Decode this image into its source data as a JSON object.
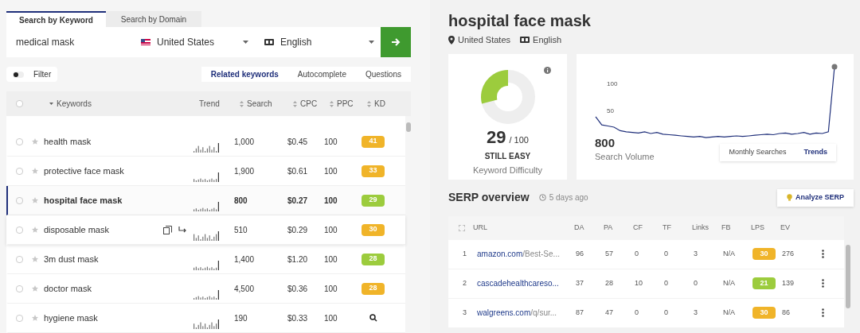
{
  "search_tabs": [
    {
      "label": "Search by Keyword",
      "selected": true
    },
    {
      "label": "Search by Domain",
      "selected": false
    }
  ],
  "search": {
    "value": "medical mask",
    "country": "United States",
    "language": "English"
  },
  "filter": {
    "label": "Filter",
    "on": false
  },
  "list_tabs": [
    {
      "label": "Related keywords",
      "selected": true
    },
    {
      "label": "Autocomplete",
      "selected": false
    },
    {
      "label": "Questions",
      "selected": false
    }
  ],
  "keyword_table": {
    "all_checked": false,
    "columns": [
      "Keywords",
      "Trend",
      "Search",
      "CPC",
      "PPC",
      "KD"
    ],
    "rows": [
      {
        "keyword": "health mask",
        "search": "1,000",
        "cpc": "$0.45",
        "ppc": "100",
        "kd": "41",
        "color": "#f0b429",
        "selected": false,
        "actions": false
      },
      {
        "keyword": "protective face mask",
        "search": "1,900",
        "cpc": "$0.61",
        "ppc": "100",
        "kd": "33",
        "color": "#f0b429",
        "selected": false,
        "actions": false
      },
      {
        "keyword": "hospital face mask",
        "search": "800",
        "cpc": "$0.27",
        "ppc": "100",
        "kd": "29",
        "color": "#9ccc3d",
        "selected": true,
        "actions": false
      },
      {
        "keyword": "disposable mask",
        "search": "510",
        "cpc": "$0.29",
        "ppc": "100",
        "kd": "30",
        "color": "#f0b429",
        "selected": false,
        "actions": true
      },
      {
        "keyword": "3m dust mask",
        "search": "1,400",
        "cpc": "$1.20",
        "ppc": "100",
        "kd": "28",
        "color": "#9ccc3d",
        "selected": false,
        "actions": false
      },
      {
        "keyword": "doctor mask",
        "search": "4,500",
        "cpc": "$0.36",
        "ppc": "100",
        "kd": "28",
        "color": "#f0b429",
        "selected": false,
        "actions": false
      },
      {
        "keyword": "hygiene mask",
        "search": "190",
        "cpc": "$0.33",
        "ppc": "100",
        "selected": false,
        "actions": false
      }
    ]
  },
  "detail": {
    "title": "hospital face mask",
    "country": "United States",
    "language": "English"
  },
  "difficulty": {
    "score": "29",
    "max": "/ 100",
    "verdict": "STILL EASY",
    "label": "Keyword Difficulty",
    "level": 0.29
  },
  "volume": {
    "value": "800",
    "label": "Search Volume",
    "tabs": [
      {
        "label": "Monthly Searches",
        "selected": false
      },
      {
        "label": "Trends",
        "selected": true
      }
    ],
    "axis_labels": [
      "100",
      "50"
    ]
  },
  "serp": {
    "title": "SERP overview",
    "updated": "5 days ago",
    "button": "Analyze SERP",
    "columns": [
      "URL",
      "DA",
      "PA",
      "CF",
      "TF",
      "Links",
      "FB",
      "LPS",
      "EV"
    ],
    "rows": [
      {
        "rank": "1",
        "domain": "amazon.com",
        "path": "/Best-Se...",
        "da": "96",
        "pa": "57",
        "cf": "0",
        "tf": "0",
        "links": "3",
        "fb": "N/A",
        "lps": "30",
        "color": "#f0b429",
        "ev": "276"
      },
      {
        "rank": "2",
        "domain": "cascadehealthcareso...",
        "path": "",
        "da": "37",
        "pa": "28",
        "cf": "10",
        "tf": "0",
        "links": "0",
        "fb": "N/A",
        "lps": "21",
        "color": "#9ccc3d",
        "ev": "139"
      },
      {
        "rank": "3",
        "domain": "walgreens.com",
        "path": "/q/sur...",
        "da": "87",
        "pa": "47",
        "cf": "0",
        "tf": "0",
        "links": "3",
        "fb": "N/A",
        "lps": "30",
        "color": "#f0b429",
        "ev": "86"
      }
    ]
  }
}
